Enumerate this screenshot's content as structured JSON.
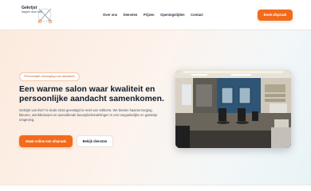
{
  "brand": {
    "name": "Gekrijst",
    "tagline": "kapper door Ilse"
  },
  "nav": {
    "links": [
      "Over ons",
      "Diensten",
      "Prijzen",
      "Openingstijden",
      "Contact"
    ],
    "book_label": "Boek afspraak"
  },
  "hero": {
    "badge": "Persoonlijke verzorging met aandacht",
    "headline": "Een warme salon waar kwaliteit en persoonlijke aandacht samenkomen.",
    "intro": "Gekrijst van Ilse? is sinds 2016 gevestigd in Heel van Valhorst. We bieden haarverzorging, kleuren, wenkbrauwen en aanvullende beautybehandelingen in een toegankelijke en gastvrije omgeving.",
    "primary_cta": "Maak online een afspraak",
    "secondary_cta": "Bekijk diensten"
  },
  "colors": {
    "accent": "#f26b1d",
    "heading": "#0f1d2e",
    "badge_text": "#d05d22"
  }
}
